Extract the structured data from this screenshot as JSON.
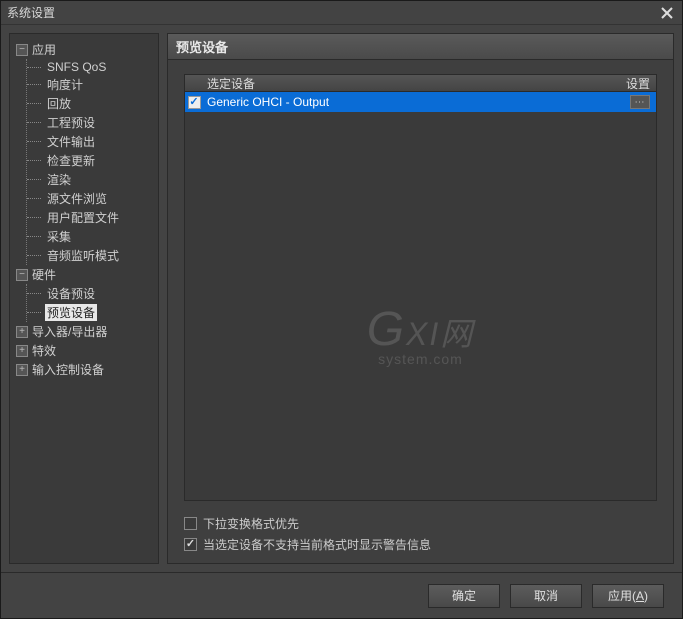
{
  "window": {
    "title": "系统设置"
  },
  "tree": {
    "application": {
      "label": "应用",
      "children": [
        "SNFS QoS",
        "响度计",
        "回放",
        "工程预设",
        "文件输出",
        "检查更新",
        "渲染",
        "源文件浏览",
        "用户配置文件",
        "采集",
        "音频监听模式"
      ]
    },
    "hardware": {
      "label": "硬件",
      "children": [
        "设备预设",
        "预览设备"
      ]
    },
    "importer_exporter": {
      "label": "导入器/导出器"
    },
    "effects": {
      "label": "特效"
    },
    "input_devices": {
      "label": "输入控制设备"
    }
  },
  "content": {
    "title": "预览设备",
    "list": {
      "header_device": "选定设备",
      "header_settings": "设置",
      "rows": [
        {
          "checked": true,
          "name": "Generic OHCI - Output",
          "settings_btn": "⋯"
        }
      ]
    },
    "options": [
      {
        "checked": false,
        "label": "下拉变换格式优先"
      },
      {
        "checked": true,
        "label": "当选定设备不支持当前格式时显示警告信息"
      }
    ]
  },
  "watermark": {
    "line1_a": "G",
    "line1_b": "XI网",
    "line2": "system.com"
  },
  "footer": {
    "ok": "确定",
    "cancel": "取消",
    "apply": "应用",
    "apply_key": "A"
  }
}
